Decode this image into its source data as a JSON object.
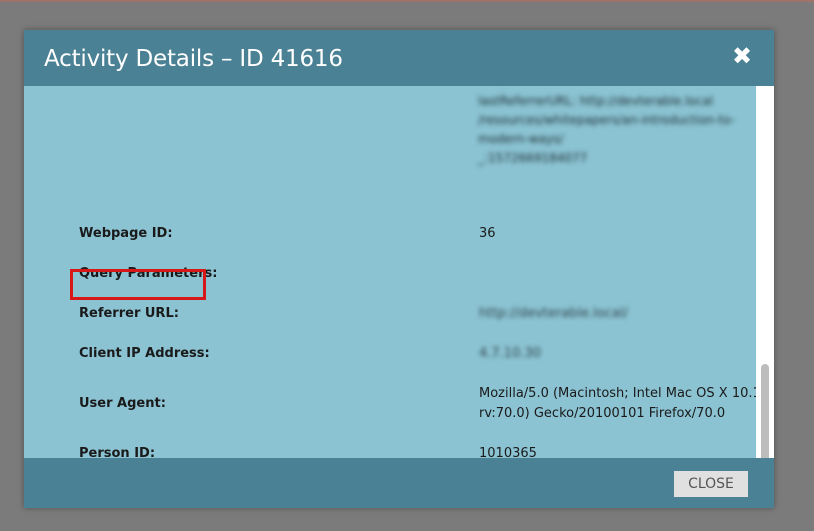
{
  "dialog": {
    "title": "Activity Details – ID 41616",
    "close_icon_glyph": "✖",
    "close_button_label": "CLOSE"
  },
  "details": {
    "blurred_top_lines": [
      "modern-ways",
      "lastReferrerURL: http://devterable.local",
      "/resources/whitepapers/an-introduction-to-",
      "modern-ways/",
      "_:1572669184077"
    ],
    "webpage_id_label": "Webpage ID:",
    "webpage_id_value": "36",
    "query_params_label": "Query Parameters:",
    "query_params_value": "",
    "referrer_url_label": "Referrer URL:",
    "referrer_url_value": "http://devterable.local/",
    "client_ip_label": "Client IP Address:",
    "client_ip_value": "4.7.10.30",
    "user_agent_label": "User Agent:",
    "user_agent_line1": "Mozilla/5.0 (Macintosh; Intel Mac OS X 10.14;",
    "user_agent_line2": "rv:70.0) Gecko/20100101 Firefox/70.0",
    "person_id_label": "Person ID:",
    "person_id_value": "1010365"
  },
  "colors": {
    "header": "#4a8194",
    "content_background": "#8bc3d2",
    "highlight": "#d81818"
  }
}
